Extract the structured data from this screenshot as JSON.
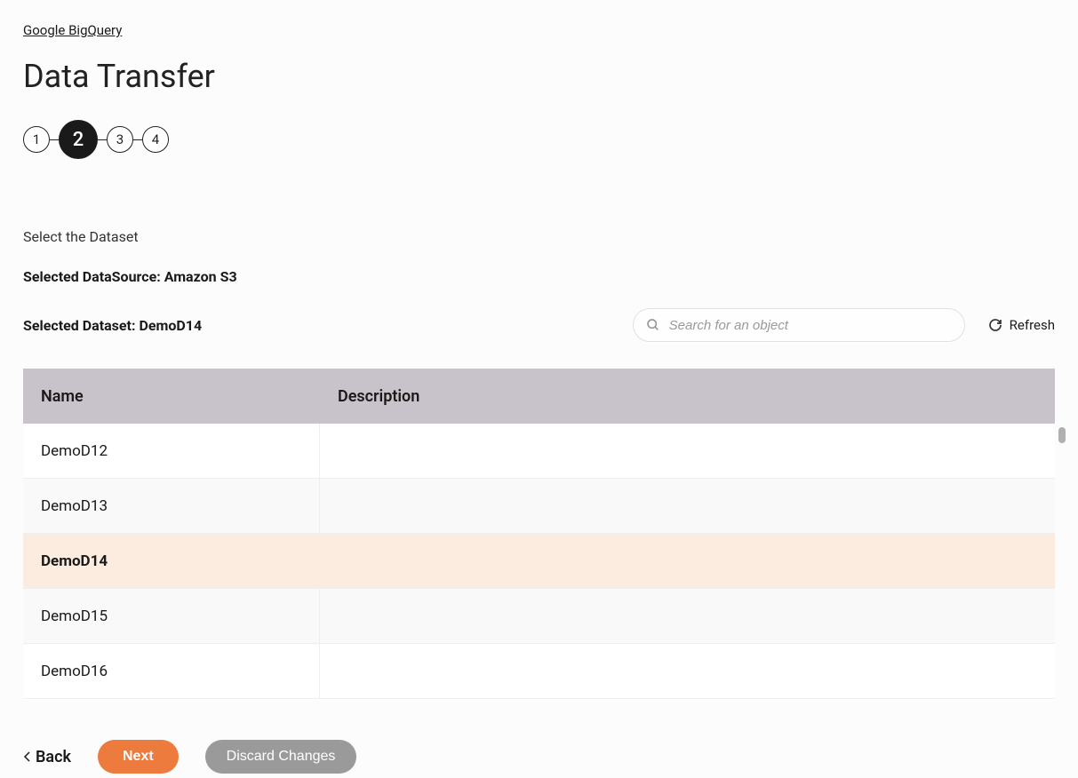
{
  "breadcrumb": {
    "label": "Google BigQuery"
  },
  "page_title": "Data Transfer",
  "stepper": {
    "steps": [
      "1",
      "2",
      "3",
      "4"
    ],
    "active_index": 1
  },
  "section_label": "Select the Dataset",
  "selected_datasource": "Selected DataSource: Amazon S3",
  "selected_dataset": "Selected Dataset: DemoD14",
  "search": {
    "placeholder": "Search for an object",
    "value": ""
  },
  "refresh_label": "Refresh",
  "table": {
    "headers": {
      "name": "Name",
      "description": "Description"
    },
    "rows": [
      {
        "name": "DemoD12",
        "description": "",
        "selected": false
      },
      {
        "name": "DemoD13",
        "description": "",
        "selected": false
      },
      {
        "name": "DemoD14",
        "description": "",
        "selected": true
      },
      {
        "name": "DemoD15",
        "description": "",
        "selected": false
      },
      {
        "name": "DemoD16",
        "description": "",
        "selected": false
      }
    ]
  },
  "footer": {
    "back_label": "Back",
    "next_label": "Next",
    "discard_label": "Discard Changes"
  }
}
